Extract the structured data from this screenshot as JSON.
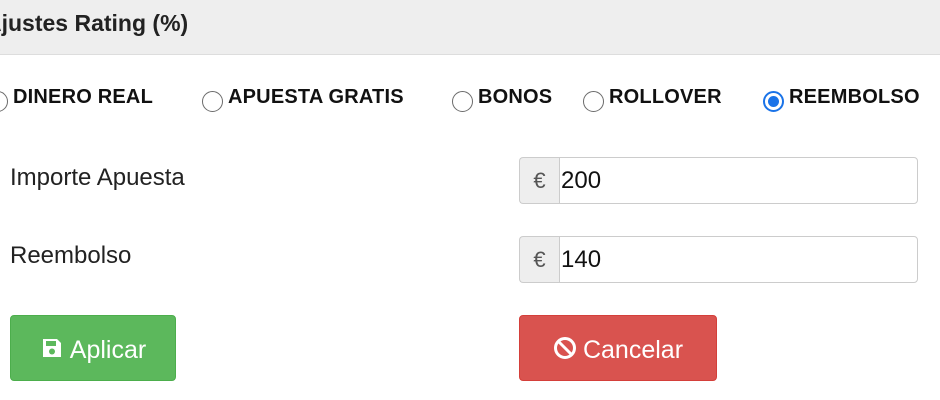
{
  "panel": {
    "title": "Ajustes Rating (%)"
  },
  "bet_type": {
    "options": [
      {
        "label": "DINERO REAL",
        "checked": false
      },
      {
        "label": "APUESTA GRATIS",
        "checked": false
      },
      {
        "label": "BONOS",
        "checked": false
      },
      {
        "label": "ROLLOVER",
        "checked": false
      },
      {
        "label": "REEMBOLSO",
        "checked": true
      }
    ]
  },
  "form": {
    "stake": {
      "label": "Importe Apuesta",
      "currency": "€",
      "value": "200"
    },
    "refund": {
      "label": "Reembolso",
      "currency": "€",
      "value": "140"
    }
  },
  "actions": {
    "apply_label": "Aplicar",
    "apply_icon": "floppy-disk-icon",
    "cancel_label": "Cancelar",
    "cancel_icon": "ban-icon"
  },
  "colors": {
    "apply_bg": "#5cb85c",
    "cancel_bg": "#d9534f",
    "radio_selected": "#1a73e8",
    "header_bg": "#eeeeee"
  }
}
